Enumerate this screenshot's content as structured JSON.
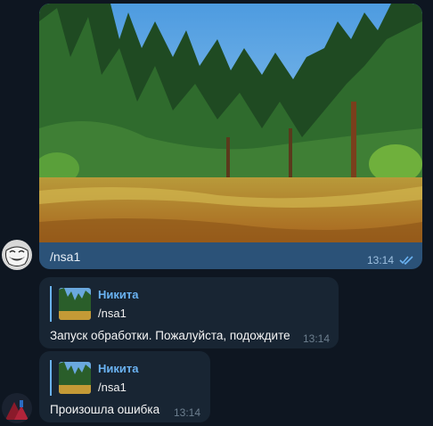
{
  "chat": {
    "outgoing": {
      "photo_icon": "forest-meadow-photo",
      "text": "/nsa1",
      "time": "13:14",
      "status_icon": "double-check-icon"
    },
    "incoming": [
      {
        "reply_author": "Никита",
        "reply_text": "/nsa1",
        "text": "Запуск обработки. Пожалуйста, подождите",
        "time": "13:14"
      },
      {
        "reply_author": "Никита",
        "reply_text": "/nsa1",
        "text": "Произошла ошибка",
        "time": "13:14"
      }
    ]
  },
  "colors": {
    "background": "#0e1621",
    "outgoing_bubble": "#2b5278",
    "incoming_bubble": "#182533",
    "accent": "#6ab2f2"
  }
}
